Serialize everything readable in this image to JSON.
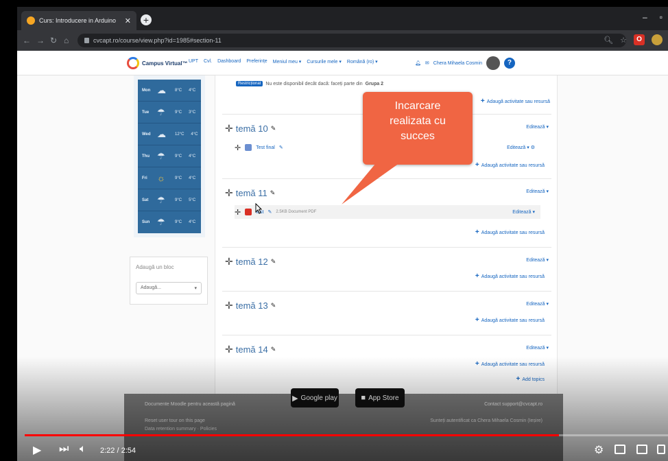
{
  "browser": {
    "tab_title": "Curs: Introducere in Arduino",
    "url": "cvcapt.ro/course/view.php?id=1985#section-11"
  },
  "nav": {
    "logo_text": "Campus Virtual™",
    "items": [
      "UPT",
      "Cvl.",
      "Dashboard",
      "Preferințe",
      "Meniul meu ▾",
      "Cursurile mele ▾",
      "Română (ro) ▾"
    ],
    "user_name": "Chera Mihaela Cosmin"
  },
  "weather": {
    "rows": [
      {
        "day": "Mon",
        "icon": "cloud-icon",
        "hi": "8°C",
        "lo": "4°C"
      },
      {
        "day": "Tue",
        "icon": "rain-icon",
        "hi": "9°C",
        "lo": "3°C"
      },
      {
        "day": "Wed",
        "icon": "cloud-icon",
        "hi": "12°C",
        "lo": "4°C"
      },
      {
        "day": "Thu",
        "icon": "rain-icon",
        "hi": "9°C",
        "lo": "4°C"
      },
      {
        "day": "Fri",
        "icon": "sun-icon",
        "hi": "9°C",
        "lo": "4°C"
      },
      {
        "day": "Sat",
        "icon": "rain-icon",
        "hi": "9°C",
        "lo": "5°C"
      },
      {
        "day": "Sun",
        "icon": "rain-icon",
        "hi": "9°C",
        "lo": "4°C"
      }
    ]
  },
  "block": {
    "title": "Adaugă un bloc",
    "select": "Adaugă..."
  },
  "restriction": {
    "tag": "Restricționat",
    "text": "Nu este disponibil decât dacă: faceți parte din",
    "group": "Grupa 2"
  },
  "common": {
    "add_activity": "Adaugă activitate sau resursă",
    "edit": "Editează ▾",
    "add_topics": "Add topics"
  },
  "topics": [
    {
      "title": "temă 10",
      "activities": [
        {
          "name": "Test final",
          "meta": ""
        }
      ]
    },
    {
      "title": "temă 11",
      "activities": [
        {
          "name": "test",
          "meta": "2.5KB Document PDF"
        }
      ]
    },
    {
      "title": "temă 12",
      "activities": []
    },
    {
      "title": "temă 13",
      "activities": []
    },
    {
      "title": "temă 14",
      "activities": []
    }
  ],
  "callout": {
    "text_lines": [
      "Incarcare",
      "realizata cu",
      "succes"
    ]
  },
  "footer": {
    "moodle_docs": "Documente Moodle pentru această pagină",
    "contact": "Contact support@cvcapt.ro",
    "reset_tour": "Reset user tour on this page",
    "data_retention": "Data retention summary · Policies",
    "logged_in": "Sunteți autentificat ca Chera Mihaela Cosmin (Ieșire)",
    "google_play": "Google play",
    "app_store": "App Store"
  },
  "player": {
    "time": "2:22 / 2:54",
    "progress": 0.83
  }
}
